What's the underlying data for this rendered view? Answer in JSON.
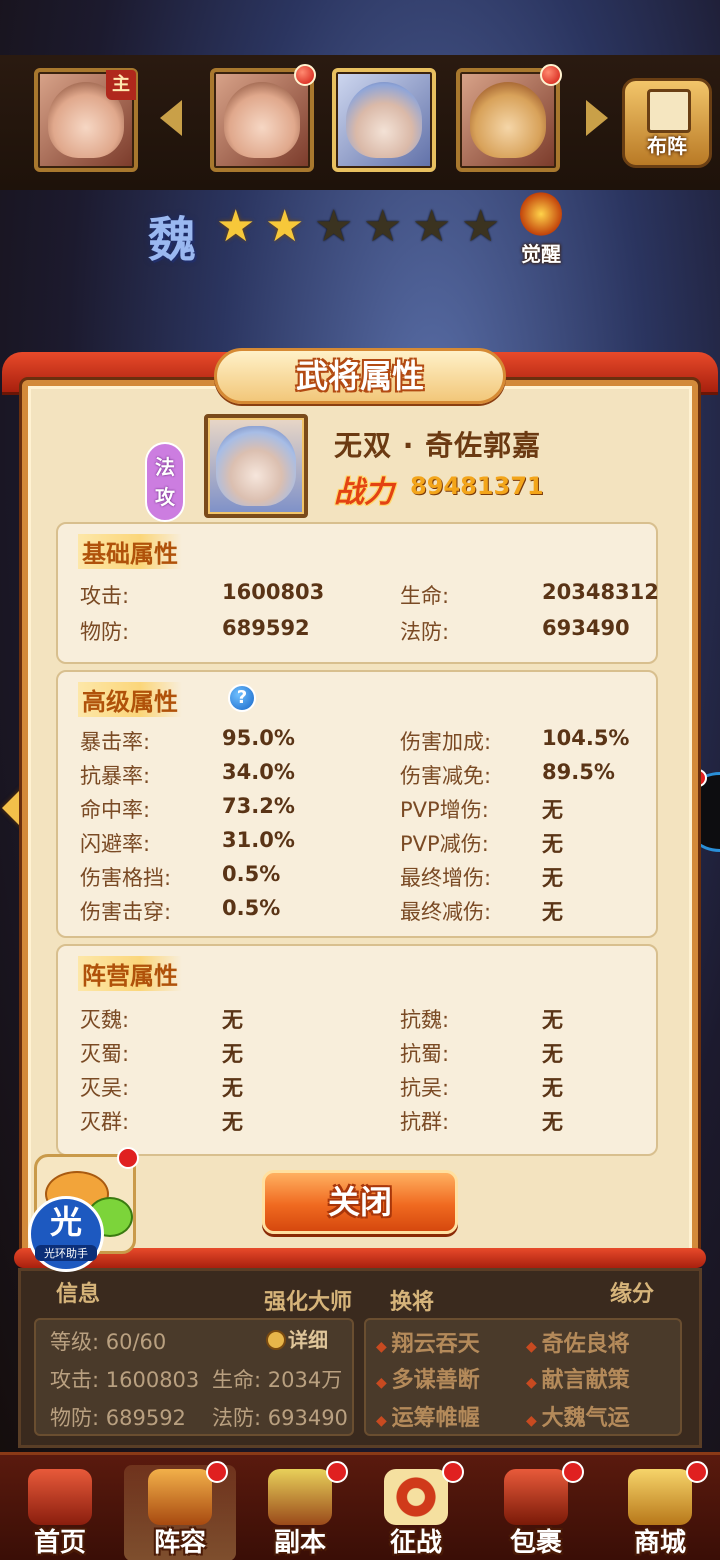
{
  "top_bar": {
    "lord_badge": "主",
    "lineup_button": "布阵"
  },
  "hero_header": {
    "faction": "魏",
    "stars_total": 6,
    "stars_lit": 2,
    "awaken_label": "觉醒"
  },
  "modal": {
    "title": "武将属性",
    "type_badge": "法攻",
    "hero_name": "无双 · 奇佐郭嘉",
    "power_label": "战力",
    "power_value": "89481371",
    "basic": {
      "title": "基础属性",
      "rows": [
        {
          "k1": "攻击:",
          "v1": "1600803",
          "k2": "生命:",
          "v2": "20348312"
        },
        {
          "k1": "物防:",
          "v1": "689592",
          "k2": "法防:",
          "v2": "693490"
        }
      ]
    },
    "advanced": {
      "title": "高级属性",
      "help": "?",
      "rows": [
        {
          "k1": "暴击率:",
          "v1": "95.0%",
          "k2": "伤害加成:",
          "v2": "104.5%"
        },
        {
          "k1": "抗暴率:",
          "v1": "34.0%",
          "k2": "伤害减免:",
          "v2": "89.5%"
        },
        {
          "k1": "命中率:",
          "v1": "73.2%",
          "k2": "PVP增伤:",
          "v2": "无"
        },
        {
          "k1": "闪避率:",
          "v1": "31.0%",
          "k2": "PVP减伤:",
          "v2": "无"
        },
        {
          "k1": "伤害格挡:",
          "v1": "0.5%",
          "k2": "最终增伤:",
          "v2": "无"
        },
        {
          "k1": "伤害击穿:",
          "v1": "0.5%",
          "k2": "最终减伤:",
          "v2": "无"
        }
      ]
    },
    "camp": {
      "title": "阵营属性",
      "rows": [
        {
          "k1": "灭魏:",
          "v1": "无",
          "k2": "抗魏:",
          "v2": "无"
        },
        {
          "k1": "灭蜀:",
          "v1": "无",
          "k2": "抗蜀:",
          "v2": "无"
        },
        {
          "k1": "灭吴:",
          "v1": "无",
          "k2": "抗吴:",
          "v2": "无"
        },
        {
          "k1": "灭群:",
          "v1": "无",
          "k2": "抗群:",
          "v2": "无"
        }
      ]
    },
    "close_label": "关闭"
  },
  "assistant": {
    "glyph": "光",
    "name": "光环助手"
  },
  "info_panel": {
    "info_title": "信息",
    "master_title": "强化大师",
    "swap_title": "换将",
    "fate_title": "缘分",
    "level": "等级: 60/60",
    "detail": "详细",
    "attack": "攻击: 1600803",
    "hp": "生命: 2034万",
    "pdef": "物防: 689592",
    "mdef": "法防: 693490",
    "fates": [
      "翔云吞天",
      "奇佐良将",
      "多谋善断",
      "献言献策",
      "运筹帷幄",
      "大魏气运"
    ]
  },
  "nav": {
    "items": [
      "首页",
      "阵容",
      "副本",
      "征战",
      "包裹",
      "商城"
    ],
    "active_index": 1
  },
  "colors": {
    "modal_bg": "#f3e3bf",
    "accent_red": "#e84a2a",
    "label_brown": "#7a4a24",
    "power_gold": "#f3a51a"
  }
}
